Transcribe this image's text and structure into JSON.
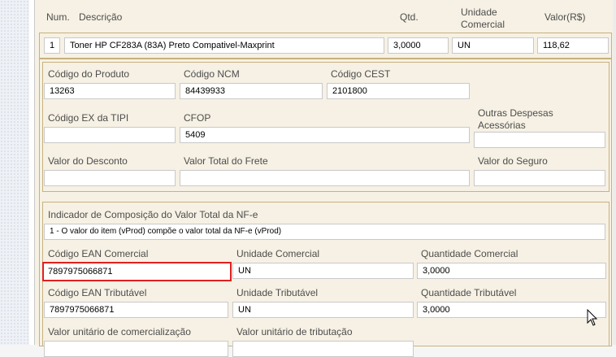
{
  "header": {
    "num": "Num.",
    "descricao": "Descrição",
    "qtd": "Qtd.",
    "unidade_comercial": "Unidade Comercial",
    "valor": "Valor(R$)"
  },
  "item": {
    "num": "1",
    "descricao": "Toner HP CF283A (83A) Preto Compativel-Maxprint",
    "qtd": "3,0000",
    "unidade": "UN",
    "valor": "118,62"
  },
  "produto": {
    "codigo_produto": {
      "label": "Código do Produto",
      "value": "13263"
    },
    "codigo_ncm": {
      "label": "Código NCM",
      "value": "84439933"
    },
    "codigo_cest": {
      "label": "Código CEST",
      "value": "2101800"
    },
    "codigo_ex_tipi": {
      "label": "Código EX da TIPI",
      "value": ""
    },
    "cfop": {
      "label": "CFOP",
      "value": "5409"
    },
    "outras_despesas": {
      "label": "Outras Despesas Acessórias",
      "value": ""
    },
    "valor_desconto": {
      "label": "Valor do Desconto",
      "value": ""
    },
    "valor_frete": {
      "label": "Valor Total do Frete",
      "value": ""
    },
    "valor_seguro": {
      "label": "Valor do Seguro",
      "value": ""
    }
  },
  "composicao": {
    "indicador": {
      "label": "Indicador de Composição do Valor Total da NF-e",
      "value": "1 - O valor do item (vProd) compõe o valor total da NF-e (vProd)"
    },
    "ean_comercial": {
      "label": "Código EAN Comercial",
      "value": "7897975066871"
    },
    "unidade_comercial": {
      "label": "Unidade Comercial",
      "value": "UN"
    },
    "quantidade_comercial": {
      "label": "Quantidade Comercial",
      "value": "3,0000"
    },
    "ean_tributavel": {
      "label": "Código EAN Tributável",
      "value": "7897975066871"
    },
    "unidade_tributavel": {
      "label": "Unidade Tributável",
      "value": "UN"
    },
    "quantidade_tributavel": {
      "label": "Quantidade Tributável",
      "value": "3,0000"
    },
    "valor_unit_comercializacao": {
      "label": "Valor unitário de comercialização",
      "value": ""
    },
    "valor_unit_tributacao": {
      "label": "Valor unitário de tributação",
      "value": ""
    }
  },
  "colors": {
    "panel_bg": "#f6f1e4",
    "frame": "#c8b17e",
    "focus": "#e02020"
  }
}
